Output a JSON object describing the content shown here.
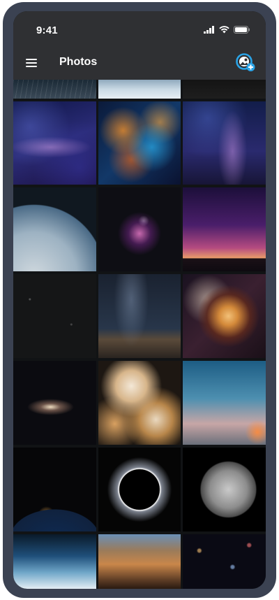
{
  "status_bar": {
    "time": "9:41"
  },
  "app_bar": {
    "title": "Photos",
    "menu_icon": "hamburger-menu-icon",
    "action_icon": "add-photo-icon",
    "accent_color": "#2aa3e6"
  },
  "photo_grid": {
    "columns": 3,
    "rows": [
      [
        "star-trails",
        "snowy-landscape",
        "dark-sky"
      ],
      [
        "milky-way-purple",
        "colorful-nebula",
        "milky-way-blue"
      ],
      [
        "earth-from-orbit",
        "orion-nebula",
        "purple-dusk-sky"
      ],
      [
        "dark-starfield",
        "milky-way-over-rocks",
        "swirling-nebula"
      ],
      [
        "andromeda-galaxy",
        "abstract-cream-shapes",
        "rocket-launch-trail"
      ],
      [
        "earth-at-night",
        "solar-eclipse",
        "full-moon"
      ],
      [
        "blue-horizon",
        "rocky-cliffs",
        "deep-field-galaxies"
      ]
    ]
  }
}
